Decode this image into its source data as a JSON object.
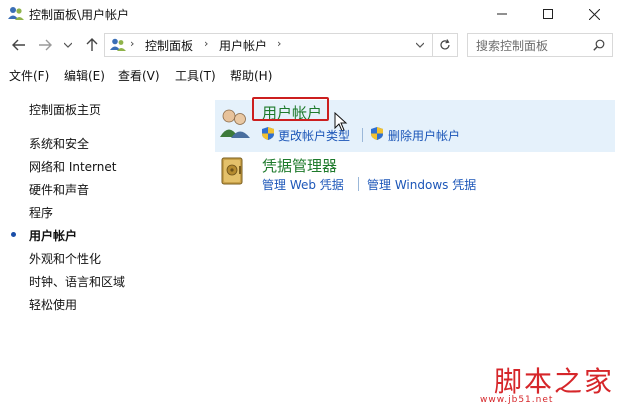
{
  "window": {
    "title": "控制面板\\用户帐户"
  },
  "address": {
    "crumbs": [
      "控制面板",
      "用户帐户"
    ],
    "search_placeholder": "搜索控制面板"
  },
  "menu": {
    "items": [
      "文件(F)",
      "编辑(E)",
      "查看(V)",
      "工具(T)",
      "帮助(H)"
    ]
  },
  "sidebar": {
    "home": "控制面板主页",
    "items": [
      "系统和安全",
      "网络和 Internet",
      "硬件和声音",
      "程序",
      "用户帐户",
      "外观和个性化",
      "时钟、语言和区域",
      "轻松使用"
    ],
    "active_index": 4
  },
  "main": {
    "categories": [
      {
        "title": "用户帐户",
        "icon": "users-icon",
        "links": [
          "更改帐户类型",
          "删除用户帐户"
        ]
      },
      {
        "title": "凭据管理器",
        "icon": "vault-icon",
        "links": [
          "管理 Web 凭据",
          "管理 Windows 凭据"
        ]
      }
    ]
  },
  "watermark": {
    "brand": "脚本之家",
    "url": "www.jb51.net"
  },
  "colors": {
    "category_title": "#1e7a2b",
    "link": "#1c56b8",
    "hover_bg": "#e5f1fb",
    "annotation_box": "#cc1f1f",
    "watermark": "#d6262a"
  }
}
